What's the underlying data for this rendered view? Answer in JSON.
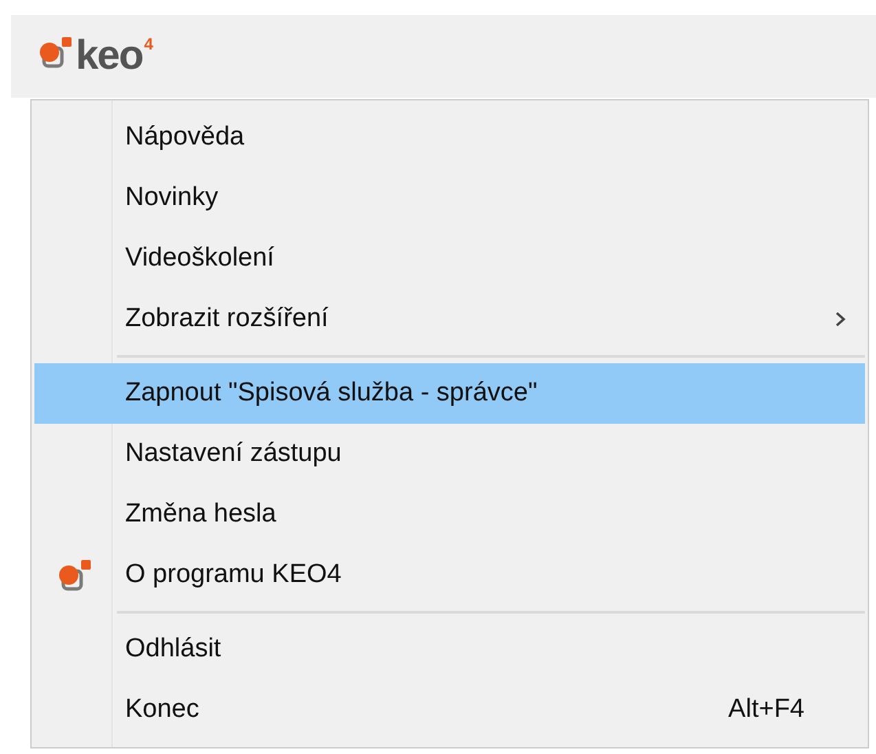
{
  "logo": {
    "text": "keo",
    "superscript": "4"
  },
  "menu": [
    {
      "kind": "plain",
      "label": "Nápověda",
      "selected": false
    },
    {
      "kind": "plain",
      "label": "Novinky",
      "selected": false
    },
    {
      "kind": "plain",
      "label": "Videoškolení",
      "selected": false
    },
    {
      "kind": "submenu",
      "label": "Zobrazit rozšíření",
      "selected": false
    },
    {
      "kind": "separator"
    },
    {
      "kind": "plain",
      "label": "Zapnout \"Spisová služba - správce\"",
      "selected": true
    },
    {
      "kind": "plain",
      "label": "Nastavení zástupu",
      "selected": false
    },
    {
      "kind": "plain",
      "label": "Změna hesla",
      "selected": false
    },
    {
      "kind": "about",
      "label": "O programu KEO4",
      "selected": false
    },
    {
      "kind": "separator"
    },
    {
      "kind": "plain",
      "label": "Odhlásit",
      "selected": false
    },
    {
      "kind": "plain",
      "label": "Konec",
      "shortcut": "Alt+F4",
      "selected": false
    }
  ]
}
